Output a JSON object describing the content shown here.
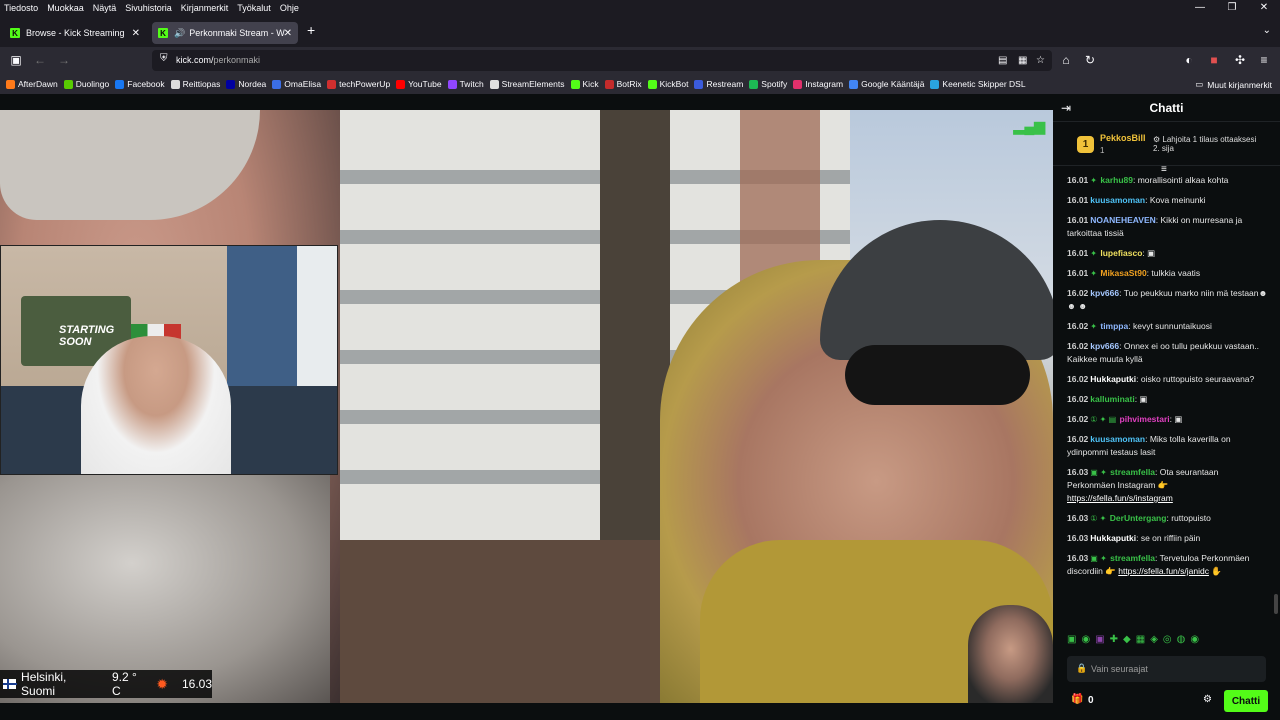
{
  "menubar": {
    "items": [
      "Tiedosto",
      "Muokkaa",
      "Näytä",
      "Sivuhistoria",
      "Kirjanmerkit",
      "Työkalut",
      "Ohje"
    ],
    "window_controls": [
      "—",
      "❐",
      "✕"
    ]
  },
  "tabs": [
    {
      "label": "Browse - Kick Streaming",
      "favicon": "K",
      "active": false
    },
    {
      "label": "Perkonmaki Stream - Watch",
      "favicon": "K",
      "active": true
    }
  ],
  "navbar": {
    "url_host": "kick.com/",
    "url_path": "perkonmaki"
  },
  "bookmarks": [
    {
      "label": "AfterDawn",
      "color": "#ff7a1a"
    },
    {
      "label": "Duolingo",
      "color": "#58cc02"
    },
    {
      "label": "Facebook",
      "color": "#1877f2"
    },
    {
      "label": "Reittiopas",
      "color": "#dddddd"
    },
    {
      "label": "Nordea",
      "color": "#0000a0"
    },
    {
      "label": "OmaElisa",
      "color": "#3b6ee6"
    },
    {
      "label": "techPowerUp",
      "color": "#d12f2f"
    },
    {
      "label": "YouTube",
      "color": "#ff0000"
    },
    {
      "label": "Twitch",
      "color": "#9146ff"
    },
    {
      "label": "StreamElements",
      "color": "#e0e0e0"
    },
    {
      "label": "Kick",
      "color": "#53fc18"
    },
    {
      "label": "BotRix",
      "color": "#c42b2b"
    },
    {
      "label": "KickBot",
      "color": "#53fc18"
    },
    {
      "label": "Restream",
      "color": "#3b5bdb"
    },
    {
      "label": "Spotify",
      "color": "#1db954"
    },
    {
      "label": "Instagram",
      "color": "#e1306c"
    },
    {
      "label": "Google Kääntäjä",
      "color": "#4285f4"
    },
    {
      "label": "Keenetic Skipper DSL",
      "color": "#2aa4e0"
    }
  ],
  "bookmarks_other": "Muut kirjanmerkit",
  "video": {
    "poster_text": "STARTING SOON",
    "weather": {
      "location": "Helsinki, Suomi",
      "temperature": "9.2 ° C",
      "time": "16.03"
    }
  },
  "chat": {
    "title": "Chatti",
    "top_gifter": {
      "rank": "1",
      "name": "PekkosBill",
      "count": "1",
      "info": "Lahjoita 1 tilaus ottaaksesi 2. sija"
    },
    "messages": [
      {
        "time": "16.01",
        "badges": "✦",
        "user": "karhu89",
        "color": "#39c148",
        "text": "morallisointi alkaa kohta"
      },
      {
        "time": "16.01",
        "badges": "",
        "user": "kuusamoman",
        "color": "#4fc3f7",
        "text": "Kova meinunki"
      },
      {
        "time": "16.01",
        "badges": "",
        "user": "NOANEHEAVEN",
        "color": "#8fb8ff",
        "text": "Kikki on murresana ja tarkoittaa tissiä"
      },
      {
        "time": "16.01",
        "badges": "✦",
        "user": "lupefiasco",
        "color": "#f0e060",
        "text": "▣"
      },
      {
        "time": "16.01",
        "badges": "✦",
        "user": "MikasaSt90",
        "color": "#f0a020",
        "text": "tulkkia vaatis"
      },
      {
        "time": "16.02",
        "badges": "",
        "user": "kpv666",
        "color": "#a6c8ff",
        "text": "Tuo peukkuu marko niin mä testaan☻ ☻ ☻"
      },
      {
        "time": "16.02",
        "badges": "✦",
        "user": "timppa",
        "color": "#8fb8ff",
        "text": "kevyt sunnuntaikuosi"
      },
      {
        "time": "16.02",
        "badges": "",
        "user": "kpv666",
        "color": "#a6c8ff",
        "text": "Onnex ei oo tullu peukkuu vastaan.. Kaikkee muuta kyllä"
      },
      {
        "time": "16.02",
        "badges": "",
        "user": "Hukkaputki",
        "color": "#ffffff",
        "text": "oisko ruttopuisto seuraavana?"
      },
      {
        "time": "16.02",
        "badges": "",
        "user": "kalluminati",
        "color": "#39c148",
        "text": "▣"
      },
      {
        "time": "16.02",
        "badges": "① ✦ ▤",
        "user": "pihvimestari",
        "color": "#e040c0",
        "text": "▣"
      },
      {
        "time": "16.02",
        "badges": "",
        "user": "kuusamoman",
        "color": "#4fc3f7",
        "text": "Miks tolla kaverilla on ydinpommi testaus lasit"
      },
      {
        "time": "16.03",
        "badges": "▣ ✦",
        "user": "streamfella",
        "color": "#39c148",
        "text": "Ota seurantaan Perkonmäen Instagram 👉",
        "link": "https://sfella.fun/s/instagram"
      },
      {
        "time": "16.03",
        "badges": "① ✦",
        "user": "DerUntergang",
        "color": "#39c148",
        "text": "ruttopuisto"
      },
      {
        "time": "16.03",
        "badges": "",
        "user": "Hukkaputki",
        "color": "#ffffff",
        "text": "se on riffiin päin"
      },
      {
        "time": "16.03",
        "badges": "▣ ✦",
        "user": "streamfella",
        "color": "#39c148",
        "text": "Tervetuloa Perkonmäen discordiin 👉",
        "link": "https://sfella.fun/s/janidc",
        "suffix": " ✋"
      }
    ],
    "input_placeholder": "Vain seuraajat",
    "gift_count": "0",
    "send_label": "Chatti"
  },
  "colors": {
    "kick_green": "#53fc18",
    "gifter_gold": "#f0c23a"
  }
}
